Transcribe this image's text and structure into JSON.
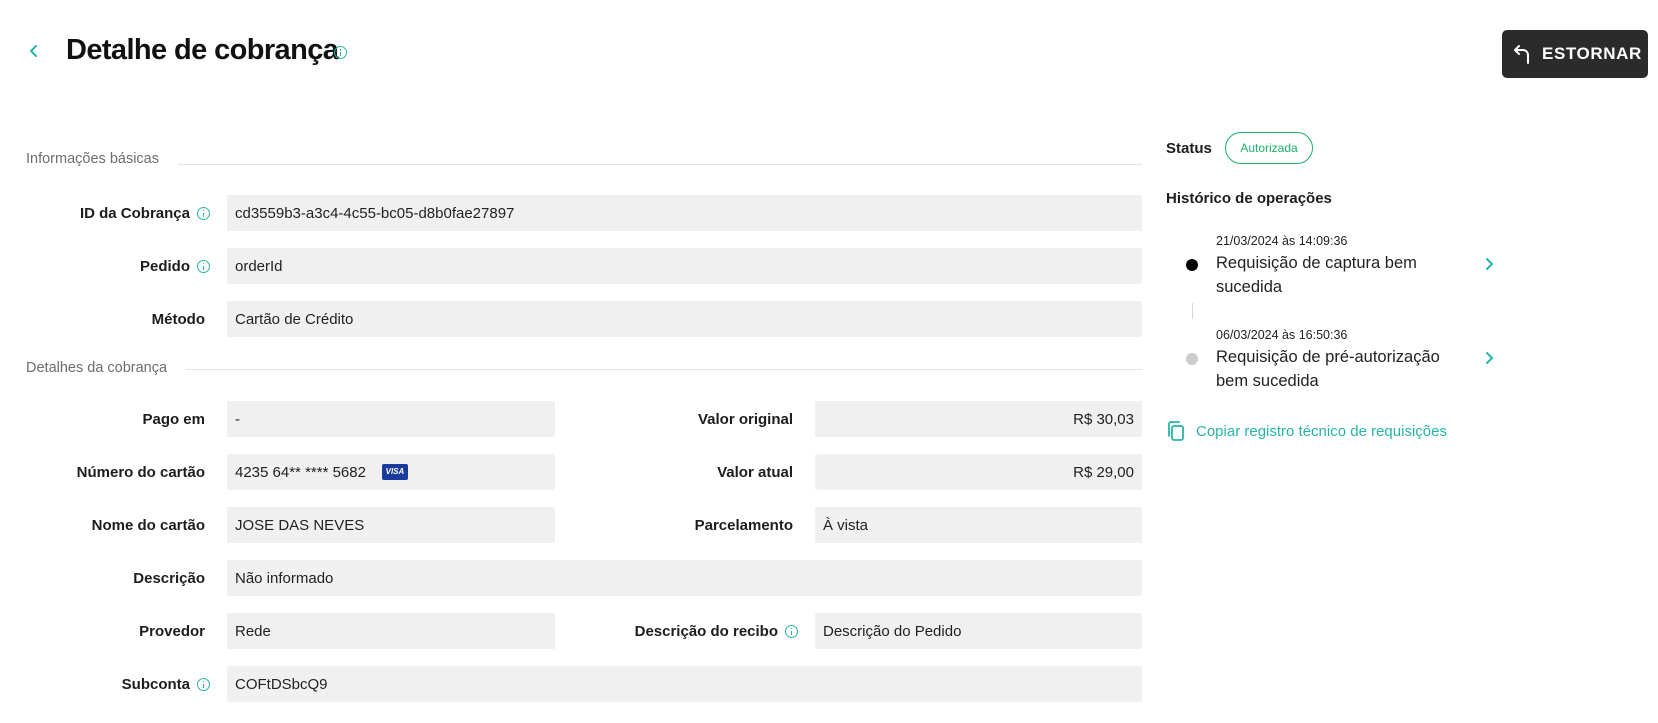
{
  "header": {
    "title": "Detalhe de cobrança",
    "refund_button": "ESTORNAR"
  },
  "sections": {
    "basic": "Informações básicas",
    "details": "Detalhes da cobrança"
  },
  "basic_fields": {
    "charge_id": {
      "label": "ID da Cobrança",
      "value": "cd3559b3-a3c4-4c55-bc05-d8b0fae27897"
    },
    "order": {
      "label": "Pedido",
      "value": "orderId"
    },
    "method": {
      "label": "Método",
      "value": "Cartão de Crédito"
    }
  },
  "detail_fields": {
    "paid_at": {
      "label": "Pago em",
      "value": "-"
    },
    "original_value": {
      "label": "Valor original",
      "value": "R$ 30,03"
    },
    "card_number": {
      "label": "Número do cartão",
      "value": "4235 64** **** 5682",
      "brand": "VISA"
    },
    "current_value": {
      "label": "Valor atual",
      "value": "R$ 29,00"
    },
    "card_name": {
      "label": "Nome do cartão",
      "value": "JOSE DAS NEVES"
    },
    "installments": {
      "label": "Parcelamento",
      "value": "À vista"
    },
    "description": {
      "label": "Descrição",
      "value": "Não informado"
    },
    "provider": {
      "label": "Provedor",
      "value": "Rede"
    },
    "receipt_description": {
      "label": "Descrição do recibo",
      "value": "Descrição do Pedido"
    },
    "subaccount": {
      "label": "Subconta",
      "value": "COFtDSbcQ9"
    }
  },
  "status": {
    "label": "Status",
    "value": "Autorizada",
    "color": "#1bb26b"
  },
  "history": {
    "title": "Histórico de operações",
    "operations": [
      {
        "date": "21/03/2024 às 14:09:36",
        "description": "Requisição de captura bem sucedida",
        "dot_color": "#000000"
      },
      {
        "date": "06/03/2024 às 16:50:36",
        "description": "Requisição de pré-autorização bem sucedida",
        "dot_color": "#cccccc"
      }
    ]
  },
  "copy_log": "Copiar registro técnico de requisições",
  "colors": {
    "accent": "#26b5a5",
    "button_dark": "#2b2b2b",
    "field_bg": "#f0f0f0"
  }
}
